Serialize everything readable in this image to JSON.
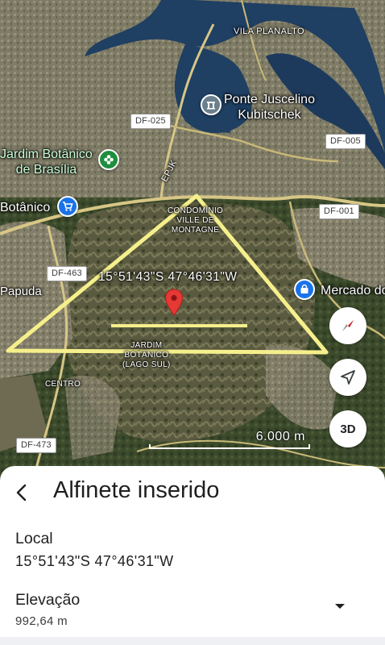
{
  "map": {
    "roads": [
      "DF-025",
      "DF-005",
      "DF-001",
      "DF-463",
      "DF-473",
      "EPJK"
    ],
    "places": {
      "vila_planalto": "VILA PLANALTO",
      "ponte": [
        "Ponte Juscelino",
        "Kubitschek"
      ],
      "jardim_botanico_brasilia": [
        "Jardim Botânico",
        "de Brasília"
      ],
      "botanico": "Botânico",
      "papuda": "Papuda",
      "mercado": "Mercado do",
      "condominio": [
        "CONDOMÍNIO",
        "VILLE DE",
        "MONTAGNE"
      ],
      "jardim_botanico_lago_sul": [
        "JARDIM",
        "BOTÂNICO",
        "(LAGO SUL)"
      ],
      "centro": "CENTRO"
    },
    "coordinates_overlay": "15°51'43\"S 47°46'31\"W",
    "scale_label": "6.000 m",
    "button_3d": "3D",
    "icons": {
      "compass": "compass-icon",
      "location": "my-location-icon",
      "pin": "red-pin-icon",
      "bridge": "landmark-icon",
      "garden": "flower-icon",
      "shop": "shopping-cart-icon",
      "market": "shopping-bag-icon"
    },
    "colors": {
      "triangle": "#f5ef8c",
      "pin": "#e53935",
      "poi_green": "#1e8e3e",
      "poi_blue": "#1a73e8"
    }
  },
  "sheet": {
    "title": "Alfinete inserido",
    "location_label": "Local",
    "location_value": "15°51'43\"S 47°46'31\"W",
    "elevation_label": "Elevação",
    "elevation_value": "992,64 m"
  }
}
